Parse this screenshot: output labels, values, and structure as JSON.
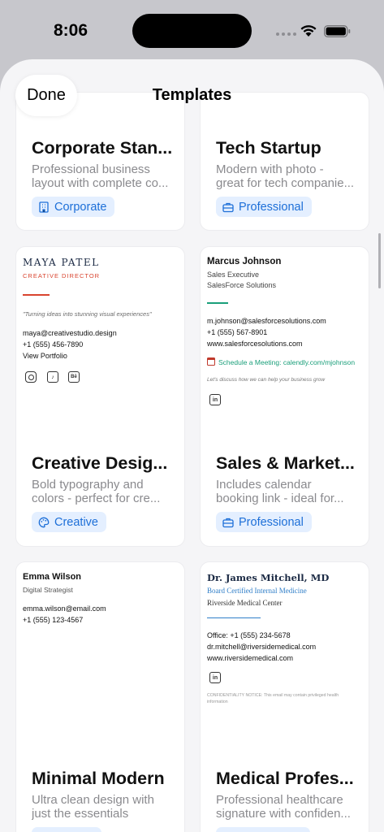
{
  "status": {
    "time": "8:06"
  },
  "nav": {
    "done_label": "Done",
    "title": "Templates"
  },
  "cards": [
    {
      "name": "Corporate Stan...",
      "desc1": "Professional business",
      "desc2": "layout with complete co...",
      "badge": "Corporate"
    },
    {
      "name": "Tech Startup",
      "desc1": "Modern with photo -",
      "desc2": "great for tech companie...",
      "badge": "Professional"
    },
    {
      "name": "Creative Desig...",
      "desc1": "Bold typography and",
      "desc2": "colors - perfect for cre...",
      "badge": "Creative"
    },
    {
      "name": "Sales & Market...",
      "desc1": "Includes calendar",
      "desc2": "booking link - ideal for...",
      "badge": "Professional"
    },
    {
      "name": "Minimal Modern",
      "desc1": "Ultra clean design with",
      "desc2": "just the essentials",
      "badge": ""
    },
    {
      "name": "Medical Profes...",
      "desc1": "Professional healthcare",
      "desc2": "signature with confiden...",
      "badge": ""
    }
  ],
  "previews": {
    "creative": {
      "name": "MAYA PATEL",
      "title": "CREATIVE DIRECTOR",
      "quote": "\"Turning ideas into stunning visual experiences\"",
      "email": "maya@creativestudio.design",
      "phone": "+1 (555) 456-7890",
      "link": "View Portfolio",
      "icons": [
        "instagram-icon",
        "tiktok-icon",
        "behance-icon"
      ],
      "accent": "#d9442f"
    },
    "sales": {
      "name": "Marcus Johnson",
      "title": "Sales Executive",
      "company": "SalesForce Solutions",
      "email": "m.johnson@salesforcesolutions.com",
      "phone": "+1 (555) 567-8901",
      "web": "www.salesforcesolutions.com",
      "meeting": "Schedule a Meeting: calendly.com/mjohnson",
      "tagline": "Let's discuss how we can help your business grow",
      "accent": "#1a9f7a"
    },
    "minimal": {
      "name": "Emma Wilson",
      "title": "Digital Strategist",
      "email": "emma.wilson@email.com",
      "phone": "+1 (555) 123-4567"
    },
    "medical": {
      "name": "Dr. James Mitchell, MD",
      "title": "Board Certified Internal Medicine",
      "org": "Riverside Medical Center",
      "phone": "Office: +1 (555) 234-5678",
      "email": "dr.mitchell@riversidemedical.com",
      "web": "www.riversidemedical.com",
      "notice1": "CONFIDENTIALITY NOTICE: This email may contain privileged health",
      "notice2": "information",
      "accent": "#2f7ec8"
    }
  }
}
